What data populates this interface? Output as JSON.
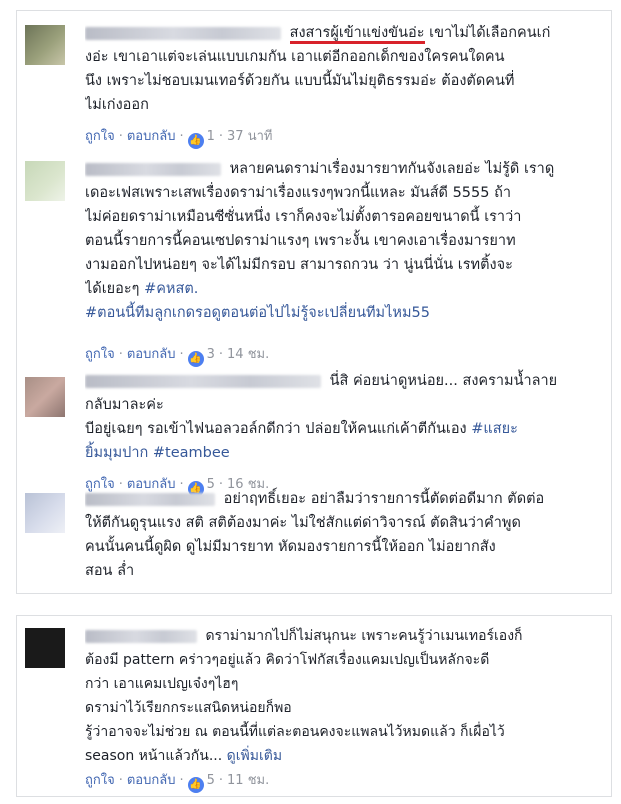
{
  "colors": {
    "link": "#365899",
    "action": "#4267b2",
    "meta": "#90949c",
    "underline": "#d8222a",
    "like": "#4d7ff0"
  },
  "comments": [
    {
      "lines": [
        "สงสารผู้เข้าแข่งขันอ่ะ",
        " เขาไม่ได้เลือกคนเก่",
        "งอ่ะ เขาเอาแต่จะเล่นแบบเกมกัน เอาแต่อีกออกเด็กของใครคนใดคน",
        "นึง เพราะไม่ชอบเมนเทอร์ด้วยกัน แบบนี้มันไม่ยุติธรรมอ่ะ ต้องตัดคนที่",
        "ไม่เก่งออก"
      ],
      "like_label": "ถูกใจ",
      "reply_label": "ตอบกลับ",
      "reactions": "1",
      "time": "37 นาที"
    },
    {
      "lines": [
        "หลายคนดราม่าเรื่องมารยาทกันจังเลยอ่ะ ไม่รู้ดิ เราดู",
        "เดอะเฟสเพราะเสพเรื่องดราม่าเรื่องแรงๆพวกนี้แหละ มันส์ดี 5555 ถ้า",
        "ไม่ค่อยดราม่าเหมือนซีซั่นหนึ่ง เราก็คงจะไม่ตั้งตารอคอยขนาดนี้ เราว่า",
        "ตอนนี้รายการนี้คอนเซปดราม่าแรงๆ เพราะงั้น เขาคงเอาเรื่องมารยาท",
        "งามออกไปหน่อยๆ จะได้ไม่มีกรอบ สามารถกวน ว่า นู่นนี่นั่น เรทติ้งจะ",
        "ได้เยอะๆ ",
        "#คหสต.",
        "#ตอนนี้ทีมลูกเกดรอดูตอนต่อไปไม่รู้จะเปลี่ยนทีมไหม55"
      ],
      "like_label": "ถูกใจ",
      "reply_label": "ตอบกลับ",
      "reactions": "3",
      "time": "14 ชม."
    },
    {
      "lines": [
        "นี่สิ ค่อยน่าดูหน่อย... สงครามน้ำลาย",
        "กลับมาละค่ะ",
        "บีอยู่เฉยๆ รอเข้าไฟนอลวอล์กดีกว่า ปล่อยให้คนแก่เค้าตีกันเอง ",
        "#แสยะ",
        "ยิ้มมุมปาก #teambee"
      ],
      "like_label": "ถูกใจ",
      "reply_label": "ตอบกลับ",
      "reactions": "5",
      "time": "16 ชม."
    },
    {
      "lines": [
        "อย่าฤทธิ์เยอะ อย่าลืมว่ารายการนี้ตัดต่อดีมาก ตัดต่อ",
        "ให้ตีกันดูรุนแรง สติ สติต้องมาค่ะ ไม่ใช่สักแต่ด่าวิจารณ์ ตัดสินว่าคำพูด",
        "คนนั้นคนนี้ดูผิด ดูไม่มีมารยาท หัดมองรายการนี้ให้ออก ไม่อยากสัง",
        "สอน ล่ำ"
      ]
    },
    {
      "lines": [
        "ดราม่ามากไปก็ไม่สนุกนะ เพราะคนรู้ว่าเมนเทอร์เองก็",
        "ต้องมี pattern คร่าวๆอยู่แล้ว คิดว่าโฟกัสเรื่องแคมเปญเป็นหลักจะดี",
        "กว่า เอาแคมเปญเจ๋งๆไฮๆ",
        "ดราม่าไว้เรียกกระแสนิดหน่อยก็พอ",
        "รู้ว่าอาจจะไม่ช่วย ณ ตอนนี้ที่แต่ละตอนคงจะแพลนไว้หมดแล้ว ก็เผื่อไว้",
        "season หน้าแล้วกัน... ",
        "ดูเพิ่มเติม"
      ],
      "like_label": "ถูกใจ",
      "reply_label": "ตอบกลับ",
      "reactions": "5",
      "time": "11 ชม."
    }
  ]
}
